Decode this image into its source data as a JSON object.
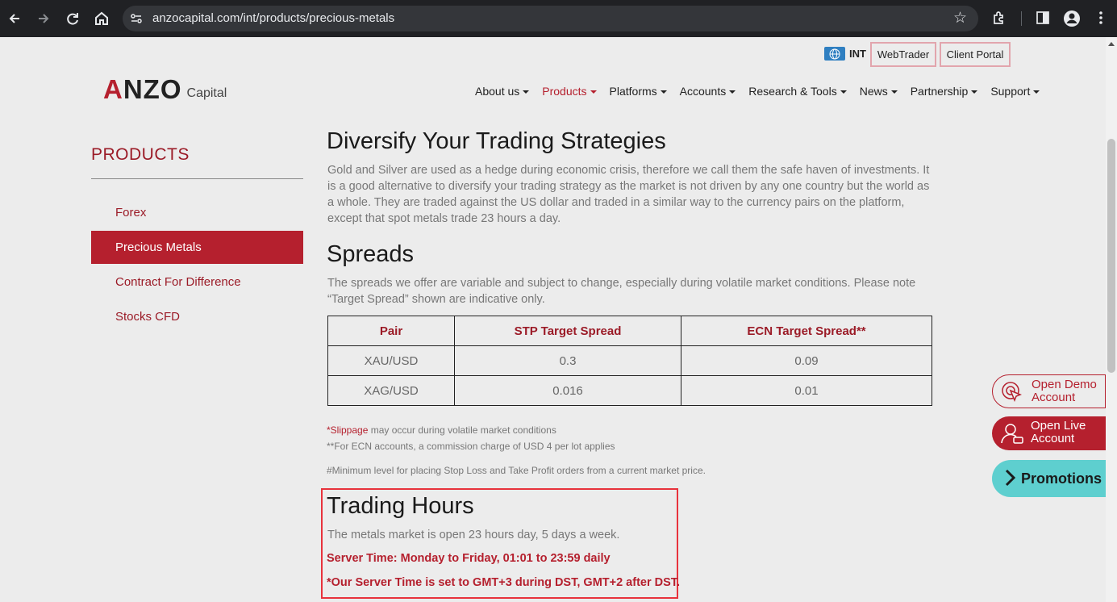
{
  "browser": {
    "url": "anzocapital.com/int/products/precious-metals"
  },
  "topbar": {
    "region": "INT",
    "webtrader": "WebTrader",
    "client_portal": "Client Portal"
  },
  "logo": {
    "main_a": "A",
    "main_rest": "NZO",
    "sub": "Capital"
  },
  "nav": [
    {
      "label": "About us"
    },
    {
      "label": "Products"
    },
    {
      "label": "Platforms"
    },
    {
      "label": "Accounts"
    },
    {
      "label": "Research & Tools"
    },
    {
      "label": "News"
    },
    {
      "label": "Partnership"
    },
    {
      "label": "Support"
    }
  ],
  "sidebar": {
    "title": "PRODUCTS",
    "items": [
      {
        "label": "Forex"
      },
      {
        "label": "Precious Metals"
      },
      {
        "label": "Contract For Difference"
      },
      {
        "label": "Stocks CFD"
      }
    ]
  },
  "main": {
    "diversify_title": "Diversify Your Trading Strategies",
    "diversify_text": "Gold and Silver are used as a hedge during economic crisis, therefore we call them the safe haven of investments. It is a good alternative to diversify your trading strategy as the market is not driven by any one country but the world as a whole. They are traded against the US dollar and traded in a similar way to the currency pairs on the platform, except that spot metals trade 23 hours a day.",
    "spreads_title": "Spreads",
    "spreads_text": "The spreads we offer are variable and subject to change, especially during volatile market conditions. Please note “Target Spread” shown are indicative only.",
    "table": {
      "headers": [
        "Pair",
        "STP Target Spread",
        "ECN Target Spread**"
      ],
      "rows": [
        [
          "XAU/USD",
          "0.3",
          "0.09"
        ],
        [
          "XAG/USD",
          "0.016",
          "0.01"
        ]
      ]
    },
    "note_slippage_link": "*Slippage",
    "note_slippage_rest": " may occur during volatile market conditions",
    "note_ecn": "**For ECN accounts, a commission charge of USD 4 per lot applies",
    "note_minimum": "#Minimum level for placing Stop Loss and Take Profit orders from a current market price.",
    "hours_title": "Trading Hours",
    "hours_text": "The metals market is open 23 hours day, 5 days a week.",
    "server_time": "Server Time: Monday to Friday, 01:01 to 23:59 daily",
    "server_note": "*Our Server Time is set to GMT+3 during DST, GMT+2 after DST."
  },
  "floating": {
    "demo_line1": "Open Demo",
    "demo_line2": "Account",
    "live_line1": "Open Live",
    "live_line2": "Account",
    "promotions": "Promotions"
  },
  "colors": {
    "brand_red": "#b5202e",
    "promo_teal": "#5ecfcf",
    "highlight": "#e8323c"
  }
}
